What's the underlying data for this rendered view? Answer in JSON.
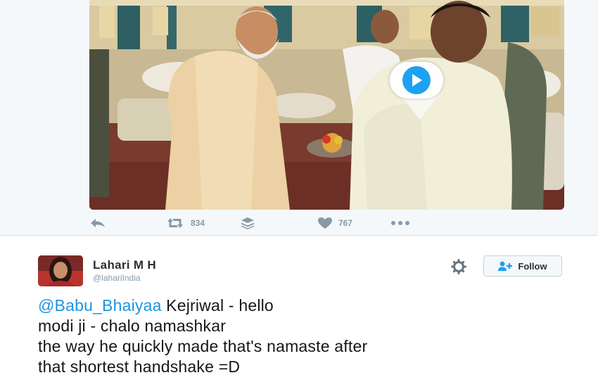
{
  "top_tweet": {
    "media": {
      "type": "video",
      "play_icon": "play-icon"
    },
    "actions": {
      "reply_icon": "reply-icon",
      "retweet_icon": "retweet-icon",
      "retweet_count": "834",
      "stack_icon": "layers-icon",
      "like_icon": "heart-icon",
      "like_count": "767",
      "more_icon": "more-icon"
    }
  },
  "tweet": {
    "name": "Lahari M H",
    "handle": "@lahariIndia",
    "follow_label": "Follow",
    "text": {
      "mention": "@Babu_Bhaiyaa",
      "line1_rest": " Kejriwal - hello",
      "line2": "modi ji - chalo namashkar",
      "line3": "the way he quickly made that's namaste after",
      "line4": "that shortest handshake =D"
    }
  },
  "colors": {
    "accent": "#1da1f2",
    "mention": "#1b95e0",
    "muted": "#8899a6",
    "text": "#14171a"
  }
}
